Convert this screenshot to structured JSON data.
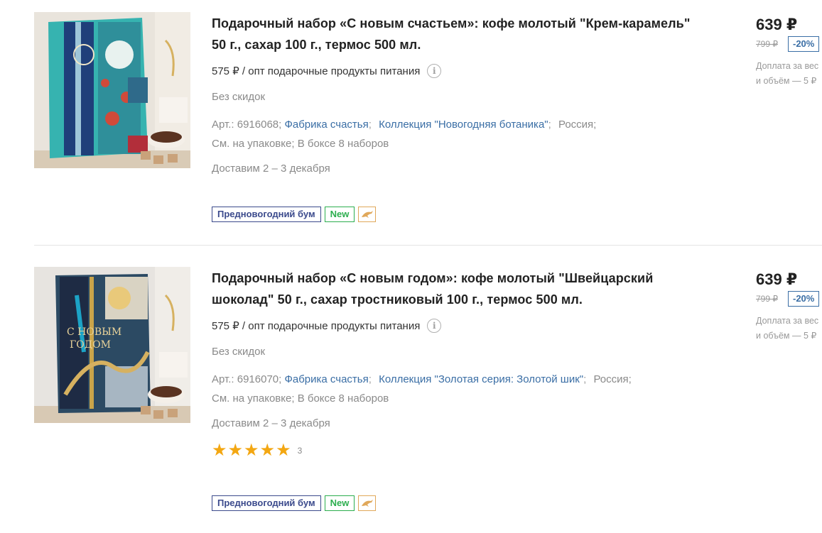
{
  "products": [
    {
      "title_line1": "Подарочный набор «С новым счастьем»: кофе молотый \"Крем-карамель\"",
      "title_line2": "50 г., сахар 100 г., термос 500 мл.",
      "opt_price": "575 ₽ / опт подарочные продукты питания",
      "no_discount": "Без скидок",
      "article": "Арт.: 6916068;",
      "brand": "Фабрика счастья",
      "collection": "Коллекция \"Новогодняя ботаника\"",
      "country": "Россия;",
      "packing_label": "См. на упаковке;",
      "packing_box": "В боксе 8 наборов",
      "delivery": "Доставим 2 – 3 декабря",
      "badge_promo": "Предновогодний бум",
      "badge_new": "New",
      "price": "639 ₽",
      "old_price": "799 ₽",
      "discount": "-20%",
      "surcharge_line1": "Доплата за вес",
      "surcharge_line2": "и объём — 5 ₽",
      "image_icon": "gift-set-photo"
    },
    {
      "title_line1": "Подарочный набор «С новым годом»: кофе молотый \"Швейцарский",
      "title_line2": "шоколад\" 50 г., сахар тростниковый 100 г., термос 500 мл.",
      "opt_price": "575 ₽ / опт подарочные продукты питания",
      "no_discount": "Без скидок",
      "article": "Арт.: 6916070;",
      "brand": "Фабрика счастья",
      "collection": "Коллекция \"Золотая серия: Золотой шик\"",
      "country": "Россия;",
      "packing_label": "См. на упаковке;",
      "packing_box": "В боксе 8 наборов",
      "delivery": "Доставим 2 – 3 декабря",
      "rating": 5,
      "rating_count": "3",
      "badge_promo": "Предновогодний бум",
      "badge_new": "New",
      "price": "639 ₽",
      "old_price": "799 ₽",
      "discount": "-20%",
      "surcharge_line1": "Доплата за вес",
      "surcharge_line2": "и объём — 5 ₽",
      "image_icon": "gift-set-photo"
    }
  ],
  "colors": {
    "link": "#3a6ea5",
    "promo_badge": "#3b4a8c",
    "new_badge": "#2cae4e",
    "star": "#f3a712",
    "dolphin_badge": "#e0a85a"
  }
}
